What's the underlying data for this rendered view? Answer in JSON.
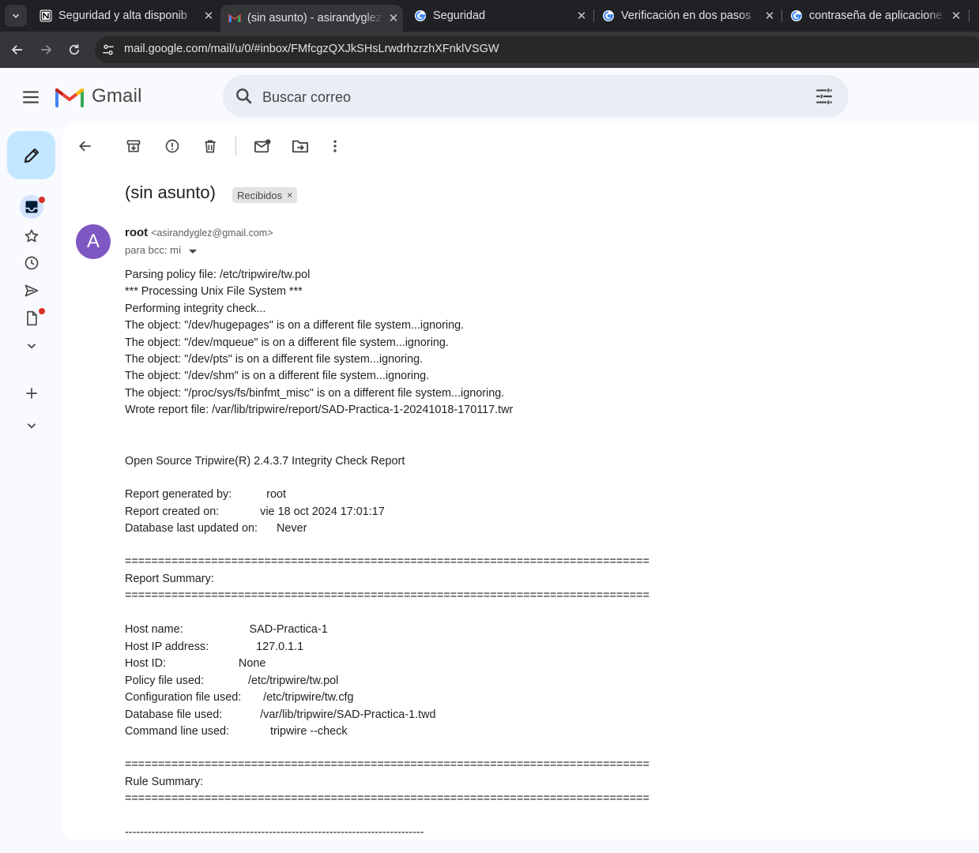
{
  "browser": {
    "tabs": [
      {
        "title": "Seguridad y alta disponib",
        "icon": "notion-icon"
      },
      {
        "title": "(sin asunto) - asirandyglez",
        "icon": "gmail-icon",
        "active": true
      },
      {
        "title": "Seguridad",
        "icon": "google-icon"
      },
      {
        "title": "Verificación en dos pasos",
        "icon": "google-icon"
      },
      {
        "title": "contraseña de aplicacione",
        "icon": "google-icon"
      }
    ],
    "close_glyph": "✕",
    "url": "mail.google.com/mail/u/0/#inbox/FMfcgzQXJkSHsLrwdrhzrzhXFnklVSGW"
  },
  "gmail": {
    "logo_text": "Gmail",
    "search_placeholder": "Buscar correo"
  },
  "message": {
    "subject": "(sin asunto)",
    "label": "Recibidos",
    "label_remove": "×",
    "avatar_letter": "A",
    "sender_name": "root",
    "sender_email": "<asirandyglez@gmail.com>",
    "recipients": "para bcc: mí",
    "body_lines": [
      "Parsing policy file: /etc/tripwire/tw.pol",
      "*** Processing Unix File System ***",
      "Performing integrity check...",
      "The object: \"/dev/hugepages\" is on a different file system...ignoring.",
      "The object: \"/dev/mqueue\" is on a different file system...ignoring.",
      "The object: \"/dev/pts\" is on a different file system...ignoring.",
      "The object: \"/dev/shm\" is on a different file system...ignoring.",
      "The object: \"/proc/sys/fs/binfmt_misc\" is on a different file system...ignoring.",
      "Wrote report file: /var/lib/tripwire/report/SAD-Practica-1-20241018-170117.twr",
      "Open Source Tripwire(R) 2.4.3.7 Integrity Check Report",
      "Report generated by:           root",
      "Report created on:             vie 18 oct 2024 17:01:17",
      "Database last updated on:      Never",
      "===============================================================================",
      "Report Summary:",
      "===============================================================================",
      "Host name:                     SAD-Practica-1",
      "Host IP address:               127.0.1.1",
      "Host ID:                       None",
      "Policy file used:              /etc/tripwire/tw.pol",
      "Configuration file used:       /etc/tripwire/tw.cfg",
      "Database file used:            /var/lib/tripwire/SAD-Practica-1.twd",
      "Command line used:             tripwire --check",
      "===============================================================================",
      "Rule Summary:",
      "===============================================================================",
      "-------------------------------------------------------------------------------"
    ]
  },
  "colors": {
    "accent": "#0b57d0",
    "compose": "#c2e7ff",
    "avatar": "#7e57c2",
    "badge": "#d93025"
  }
}
